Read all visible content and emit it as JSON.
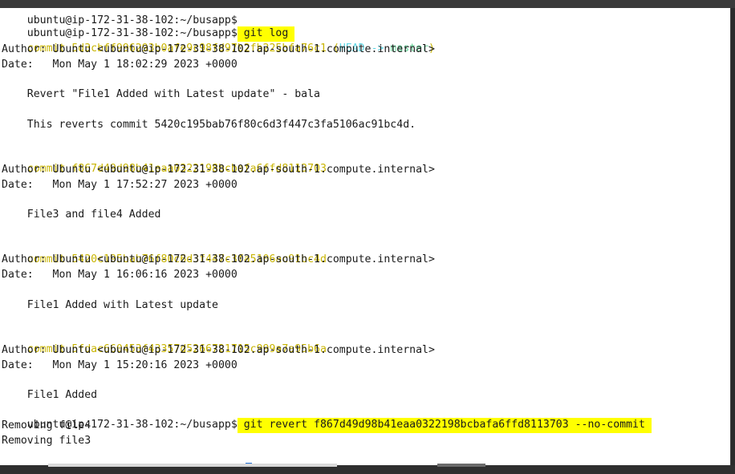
{
  "terminal": {
    "partial_top": "ubuntu@ip-172-31-38-102:~/busapp$",
    "prompt": "ubuntu@ip-172-31-38-102:~/busapp$",
    "cmd1": " git log ",
    "commit_word": "commit",
    "head_open": "(",
    "head_label": "HEAD",
    "head_arrow": " -> ",
    "master_label": "master",
    "head_close": ")",
    "commits": [
      {
        "hash": "5d3cbff996293b0afe9c98fd97b2fb225bfa76c1",
        "author": "Author: Ubuntu <ubuntu@ip-172-31-38-102.ap-south-1.compute.internal>",
        "date": "Date:   Mon May 1 18:02:29 2023 +0000",
        "message": "    Revert \"File1 Added with Latest update\" - bala",
        "message2": "    This reverts commit 5420c195bab76f80c6d3f447c3fa5106ac91bc4d."
      },
      {
        "hash": "f867d49d98b41eaa0322198bcbafa6ffd8113703",
        "author": "Author: Ubuntu <ubuntu@ip-172-31-38-102.ap-south-1.compute.internal>",
        "date": "Date:   Mon May 1 17:52:27 2023 +0000",
        "message": "    File3 and file4 Added"
      },
      {
        "hash": "5420c195bab76f80c6d3f447c3fa5106ac91bc4d",
        "author": "Author: Ubuntu <ubuntu@ip-172-31-38-102.ap-south-1.compute.internal>",
        "date": "Date:   Mon May 1 16:06:16 2023 +0000",
        "message": "    File1 Added with Latest update"
      },
      {
        "hash": "5fdac660453f43357d5266721715c999a7a95b6a",
        "author": "Author: Ubuntu <ubuntu@ip-172-31-38-102.ap-south-1.compute.internal>",
        "date": "Date:   Mon May 1 15:20:16 2023 +0000",
        "message": "    File1 Added"
      }
    ],
    "cmd2": " git revert f867d49d98b41eaa0322198bcbafa6ffd8113703 --no-commit ",
    "output": [
      "Removing file4",
      "Removing file3"
    ]
  },
  "colors": {
    "highlight": "#ffff00",
    "commit_hash": "#c8b400",
    "head": "#5fd7e6",
    "master": "#67d49a",
    "cursor": "#1f6fd1"
  }
}
